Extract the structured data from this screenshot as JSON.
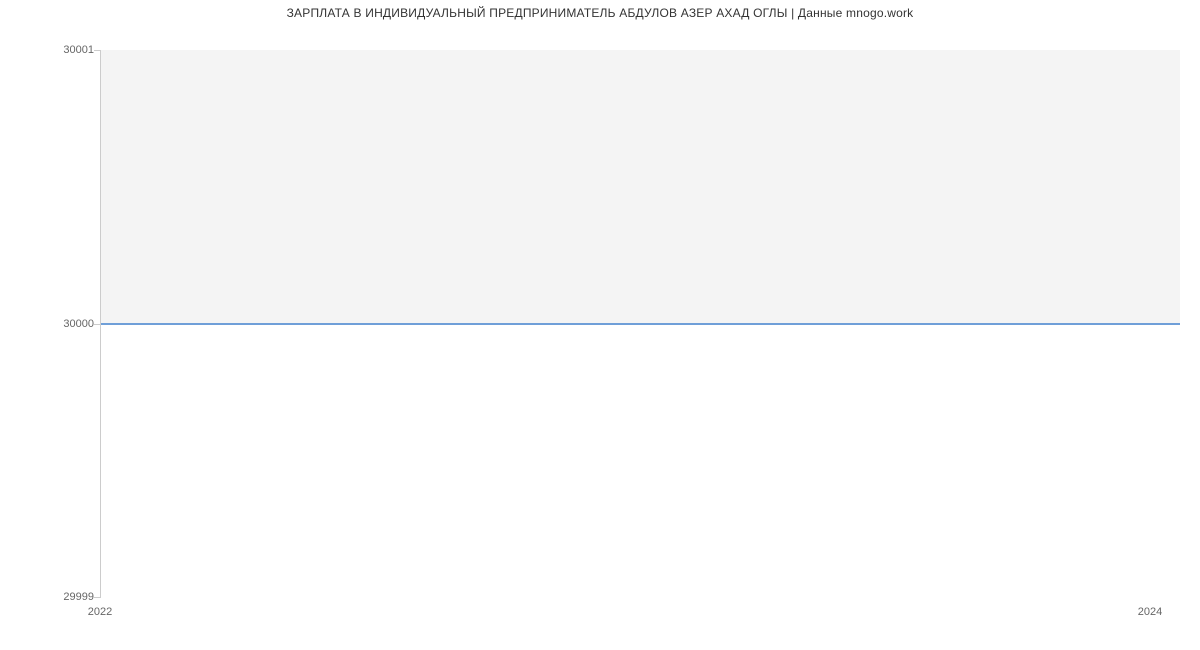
{
  "chart_data": {
    "type": "area",
    "title": "ЗАРПЛАТА В ИНДИВИДУАЛЬНЫЙ ПРЕДПРИНИМАТЕЛЬ АБДУЛОВ АЗЕР АХАД ОГЛЫ | Данные mnogo.work",
    "x": [
      2022,
      2024
    ],
    "values": [
      30000,
      30000
    ],
    "xlabel": "",
    "ylabel": "",
    "ylim": [
      29999,
      30001
    ],
    "xlim": [
      2022,
      2024
    ],
    "y_ticks": [
      29999,
      30000,
      30001
    ],
    "x_ticks": [
      2022,
      2024
    ],
    "series_color": "#6f9fd8",
    "fill_color": "#f4f4f4"
  },
  "ticks": {
    "y0": "29999",
    "y1": "30000",
    "y2": "30001",
    "x0": "2022",
    "x1": "2024"
  }
}
